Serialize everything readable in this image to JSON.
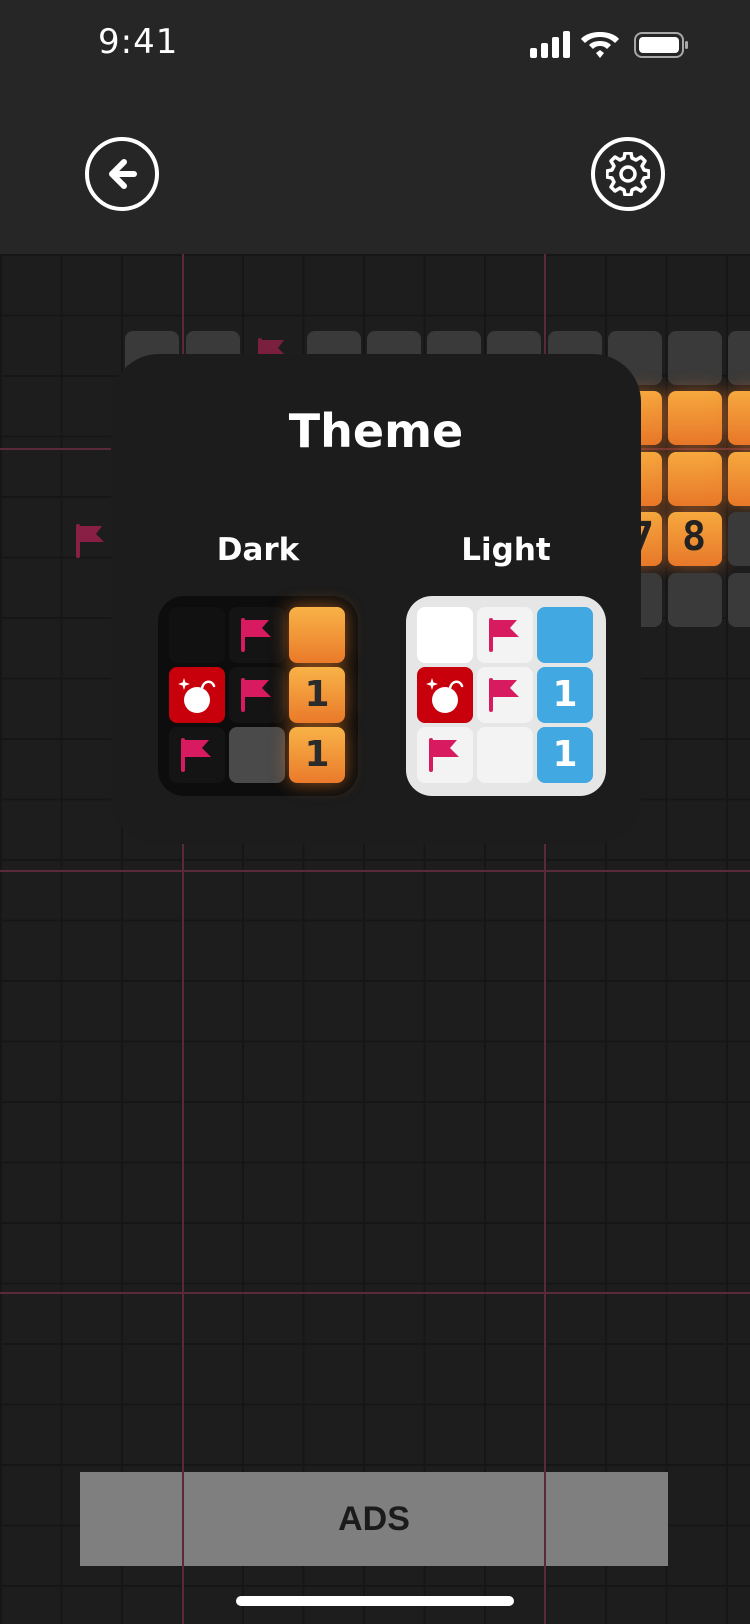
{
  "status_bar": {
    "time": "9:41"
  },
  "header": {
    "back_icon": "arrow-left-icon",
    "settings_icon": "gear-icon"
  },
  "board": {
    "numbers": [
      "7",
      "8"
    ]
  },
  "theme_modal": {
    "title": "Theme",
    "options": [
      {
        "label": "Dark",
        "cell_number": "1"
      },
      {
        "label": "Light",
        "cell_number": "1"
      }
    ]
  },
  "ads": {
    "label": "ADS"
  },
  "colors": {
    "flag": "#d81b60",
    "bomb_bg": "#c7000b",
    "orange_top": "#f6a83e",
    "orange_bottom": "#e8782a",
    "light_blue": "#42a8e2",
    "grid_line": "#5a2a38"
  }
}
